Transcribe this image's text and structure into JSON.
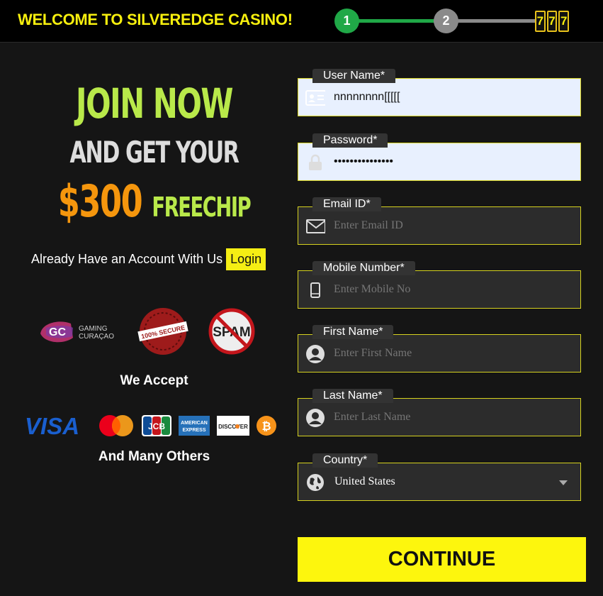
{
  "header": {
    "welcome": "WELCOME TO SILVEREDGE CASINO!",
    "steps": [
      "1",
      "2"
    ],
    "current_step": 1,
    "slot_symbols": [
      "7",
      "7",
      "7"
    ]
  },
  "promo": {
    "line1": "JOIN NOW",
    "line2": "AND GET YOUR",
    "amount": "$300",
    "freechip": "FREECHIP",
    "account_text": "Already Have an Account With Us",
    "login_label": "Login"
  },
  "badges": {
    "gaming_logo_text": "GC",
    "gaming_name_line1": "GAMING",
    "gaming_name_line2": "CURAÇAO",
    "secure_text": "100% SECURE",
    "spam_text": "SPAM"
  },
  "accept_title": "We Accept",
  "payments": {
    "visa": "VISA",
    "jcb": "JCB",
    "amex_line1": "AMERICAN",
    "amex_line2": "EXPRESS",
    "discover": "DISCOVER"
  },
  "many_others": "And Many Others",
  "form": {
    "username": {
      "label": "User Name*",
      "value": "nnnnnnnn[[[[[",
      "placeholder": ""
    },
    "password": {
      "label": "Password*",
      "value": "•••••••••••••••"
    },
    "email": {
      "label": "Email ID*",
      "value": "",
      "placeholder": "Enter Email ID"
    },
    "mobile": {
      "label": "Mobile Number*",
      "value": "",
      "placeholder": "Enter Mobile No"
    },
    "first_name": {
      "label": "First Name*",
      "value": "",
      "placeholder": "Enter First Name"
    },
    "last_name": {
      "label": "Last Name*",
      "value": "",
      "placeholder": "Enter Last Name"
    },
    "country": {
      "label": "Country*",
      "selected": "United States"
    },
    "continue_label": "CONTINUE"
  },
  "colors": {
    "accent_yellow": "#fdf60d",
    "step_active": "#20a847",
    "step_inactive": "#8a8a8a",
    "promo_green": "#b9e94a",
    "promo_orange": "#f5960d"
  }
}
